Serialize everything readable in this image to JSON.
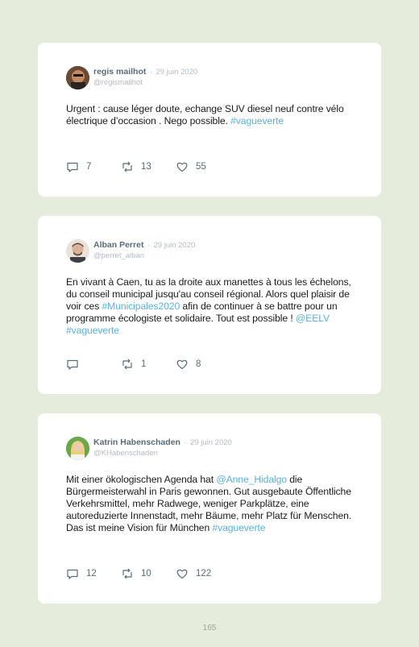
{
  "tweets": [
    {
      "name": "regis mailhot",
      "date": "29 juin 2020",
      "handle": "@regismailhot",
      "text_parts": [
        {
          "t": "Urgent : cause léger doute, echange SUV diesel neuf contre vélo électrique d’occasion . Nego possible. "
        },
        {
          "t": "#vagueverte",
          "tag": true
        }
      ],
      "replies": "7",
      "retweets": "13",
      "likes": "55"
    },
    {
      "name": "Alban Perret",
      "date": "29 juin 2020",
      "handle": "@perret_alban",
      "text_parts": [
        {
          "t": "En vivant à Caen, tu as la droite aux manettes à tous les échelons, du conseil municipal jusqu'au conseil régional. Alors quel plaisir de voir ces "
        },
        {
          "t": "#Municipales2020",
          "tag": true
        },
        {
          "t": " afin de continuer à se battre pour un programme écologiste et solidaire. Tout est possible ! "
        },
        {
          "t": "@EELV",
          "tag": true
        },
        {
          "t": " "
        },
        {
          "t": "#vagueverte",
          "tag": true
        }
      ],
      "replies": "",
      "retweets": "1",
      "likes": "8"
    },
    {
      "name": "Katrin Habenschaden",
      "date": "29 juin 2020",
      "handle": "@KHabenschaden",
      "text_parts": [
        {
          "t": "Mit einer ökologischen Agenda hat "
        },
        {
          "t": "@Anne_Hidalgo",
          "tag": true
        },
        {
          "t": " die Bürgermeisterwahl in Paris gewonnen. Gut ausgebaute Öffentliche Verkehrsmittel, mehr Radwege, weniger Parkplätze, eine autoreduzierte Innenstadt, mehr Bäume, mehr Platz für Menschen. Das ist meine Vision für München "
        },
        {
          "t": "#vagueverte",
          "tag": true
        }
      ],
      "replies": "12",
      "retweets": "10",
      "likes": "122"
    }
  ],
  "separator": "·",
  "page_number": "165",
  "colors": {
    "background": "#e6ecdc",
    "card": "#ffffff",
    "link": "#5bb0de",
    "name": "#5a6b78",
    "muted": "#b3bbc2"
  }
}
